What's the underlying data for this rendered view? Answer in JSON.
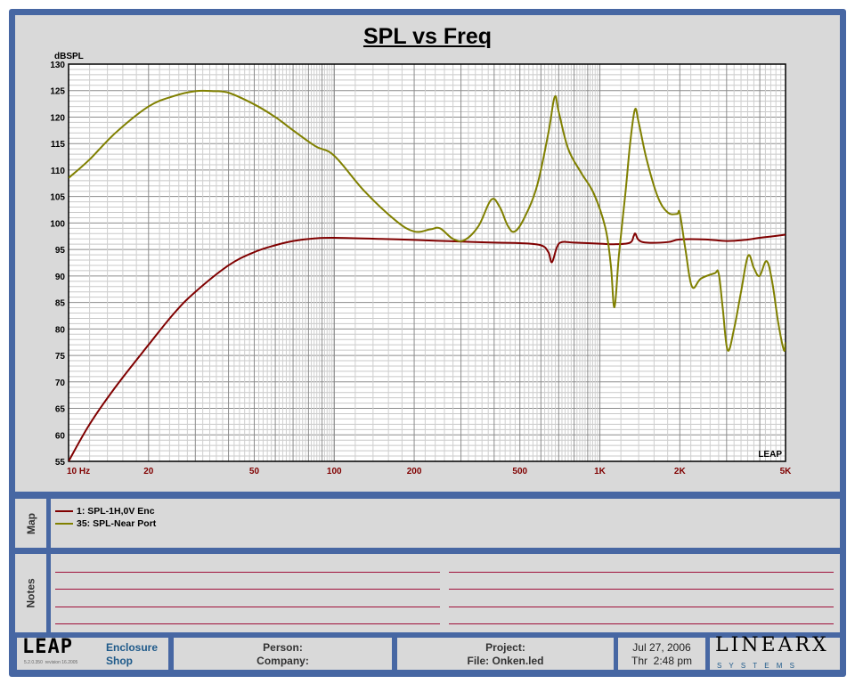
{
  "chart_data": {
    "type": "line",
    "title": "SPL vs Freq",
    "ylabel": "dBSPL",
    "xlabel": "",
    "xscale": "log",
    "xlim": [
      10,
      5000
    ],
    "ylim": [
      55,
      130
    ],
    "grid": true,
    "x_ticks": [
      {
        "v": 10,
        "label": "10  Hz"
      },
      {
        "v": 20,
        "label": "20"
      },
      {
        "v": 50,
        "label": "50"
      },
      {
        "v": 100,
        "label": "100"
      },
      {
        "v": 200,
        "label": "200"
      },
      {
        "v": 500,
        "label": "500"
      },
      {
        "v": 1000,
        "label": "1K"
      },
      {
        "v": 2000,
        "label": "2K"
      },
      {
        "v": 5000,
        "label": "5K"
      }
    ],
    "y_ticks": [
      55,
      60,
      65,
      70,
      75,
      80,
      85,
      90,
      95,
      100,
      105,
      110,
      115,
      120,
      125,
      130
    ],
    "watermark": "LEAP",
    "series": [
      {
        "name": "1: SPL-1H,0V Enc",
        "color": "#800000",
        "x": [
          10,
          12,
          15,
          20,
          25,
          30,
          40,
          50,
          60,
          70,
          85,
          100,
          150,
          200,
          300,
          400,
          500,
          600,
          640,
          660,
          690,
          720,
          800,
          1000,
          1150,
          1300,
          1340,
          1360,
          1400,
          1500,
          1800,
          2000,
          2500,
          3000,
          3500,
          4000,
          4500,
          5000
        ],
        "y": [
          55,
          62,
          69,
          77,
          83,
          87,
          92,
          94.5,
          95.8,
          96.6,
          97.1,
          97.2,
          97,
          96.8,
          96.5,
          96.3,
          96.2,
          95.8,
          94.5,
          92.6,
          95.5,
          96.4,
          96.3,
          96.1,
          96,
          96.3,
          97.5,
          98,
          96.8,
          96.3,
          96.4,
          96.9,
          96.9,
          96.6,
          96.8,
          97.2,
          97.5,
          97.8
        ]
      },
      {
        "name": "35: SPL-Near Port",
        "color": "#808000",
        "x": [
          10,
          12,
          15,
          20,
          25,
          30,
          35,
          40,
          50,
          60,
          70,
          85,
          100,
          130,
          170,
          200,
          230,
          250,
          280,
          310,
          350,
          390,
          420,
          450,
          478,
          520,
          580,
          640,
          676,
          700,
          760,
          850,
          950,
          1050,
          1100,
          1135,
          1180,
          1250,
          1300,
          1355,
          1400,
          1500,
          1650,
          1800,
          1950,
          2000,
          2100,
          2222,
          2400,
          2700,
          2800,
          2900,
          3027,
          3200,
          3400,
          3614,
          3800,
          3991,
          4240,
          4450,
          4700,
          4930,
          5000
        ],
        "y": [
          108.5,
          112,
          117,
          122,
          124,
          124.9,
          124.9,
          124.6,
          122.4,
          120,
          117.5,
          114.5,
          112.7,
          106,
          100.5,
          98.4,
          98.8,
          99,
          97,
          96.8,
          99.5,
          104.4,
          103,
          99.5,
          98.4,
          101,
          107,
          117,
          123.8,
          121,
          114,
          109.5,
          105.5,
          99,
          92,
          84.1,
          94,
          106,
          115,
          121.4,
          119,
          112,
          105,
          102,
          101.7,
          101.8,
          95,
          88,
          89.5,
          90.5,
          90.5,
          84,
          76,
          80,
          87,
          93.8,
          91.5,
          90,
          92.8,
          89,
          81,
          76,
          77.5
        ]
      }
    ]
  },
  "map": {
    "label": "Map"
  },
  "notes": {
    "label": "Notes"
  },
  "footer": {
    "logo": "LEAP",
    "version": "5.2.0.350",
    "revision": "revision 16.2005",
    "product_line1": "Enclosure",
    "product_line2": "Shop",
    "person": "Person:",
    "company": "Company:",
    "project": "Project:",
    "file": "File: Onken.led",
    "date": "Jul 27, 2006",
    "time": "Thr  2:48 pm",
    "brand": "LINEARX",
    "brand_sub": "S Y S T E M S"
  }
}
